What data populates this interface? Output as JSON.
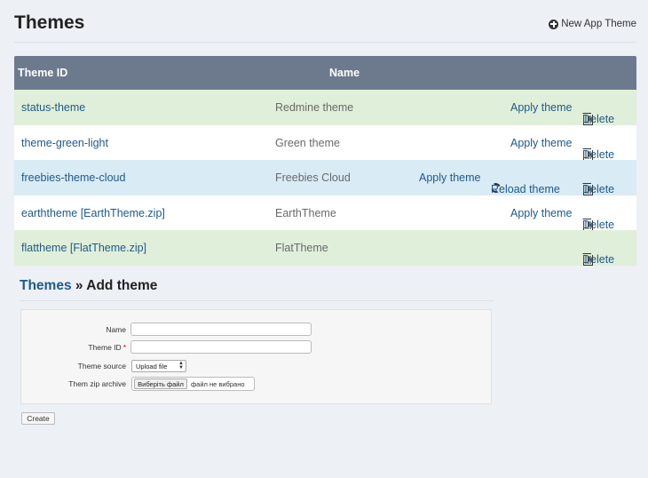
{
  "header": {
    "title": "Themes",
    "new_theme_label": "New App Theme"
  },
  "table": {
    "columns": [
      "Theme ID",
      "Name"
    ],
    "rows": [
      {
        "id": "status-theme",
        "name": "Redmine theme",
        "apply": "Apply theme",
        "reload": "",
        "delete": "Delete"
      },
      {
        "id": "theme-green-light",
        "name": "Green theme",
        "apply": "Apply theme",
        "reload": "",
        "delete": "Delete"
      },
      {
        "id": "freebies-theme-cloud",
        "name": "Freebies Cloud",
        "apply": "Apply theme",
        "reload": "Reload theme",
        "delete": "Delete"
      },
      {
        "id": "earththeme [EarthTheme.zip]",
        "name": "EarthTheme",
        "apply": "Apply theme",
        "reload": "",
        "delete": "Delete"
      },
      {
        "id": "flattheme [FlatTheme.zip]",
        "name": "FlatTheme",
        "apply": "",
        "reload": "",
        "delete": "Delete"
      }
    ]
  },
  "add_form": {
    "breadcrumb": "Themes",
    "separator": " » ",
    "title": "Add theme",
    "name_label": "Name",
    "name_value": "",
    "theme_id_label": "Theme ID",
    "required_mark": "*",
    "theme_id_value": "",
    "source_label": "Theme source",
    "source_selected": "Upload file",
    "zip_label": "Them zip archive",
    "file_button": "Виберіть файл",
    "file_status": "файл не вибрано",
    "create_label": "Create"
  },
  "colors": {
    "header_bg": "#6d7a8e",
    "link": "#1f5a8b",
    "row_green": "#e0efd9",
    "row_blue": "#d9ebf5"
  }
}
